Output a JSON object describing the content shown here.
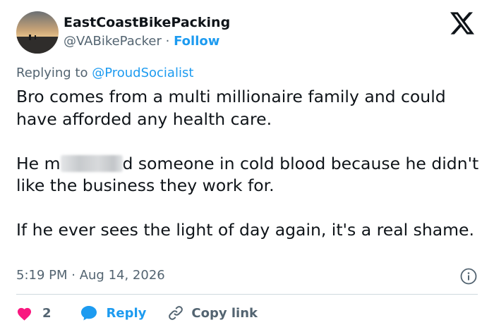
{
  "author": {
    "display_name": "EastCoastBikePacking",
    "handle": "@VABikePacker",
    "separator": " · ",
    "follow_label": "Follow"
  },
  "reply_context": {
    "prefix": "Replying to ",
    "mention": "@ProudSocialist"
  },
  "body": {
    "paragraph_1": "Bro comes from a multi millionaire family and could have afforded any health care.",
    "paragraph_2_start": "He m",
    "paragraph_2_end": "d someone in cold blood because he didn't like the business they work for.",
    "paragraph_3": "If he ever sees the light of day again, it's a real shame."
  },
  "timestamp": {
    "time": "5:19 PM",
    "separator": " · ",
    "date": "Aug 14, 2026"
  },
  "actions": {
    "like_count": "2",
    "reply_label": "Reply",
    "copy_label": "Copy link"
  },
  "icons": {
    "brand": "x-logo-icon",
    "info": "info-icon",
    "like": "heart-icon",
    "reply": "speech-bubble-icon",
    "copy": "link-icon"
  },
  "colors": {
    "text": "#0f1419",
    "secondary": "#536471",
    "accent_blue": "#1d9bf0",
    "like_red": "#f91880",
    "divider": "#cfd9de"
  }
}
